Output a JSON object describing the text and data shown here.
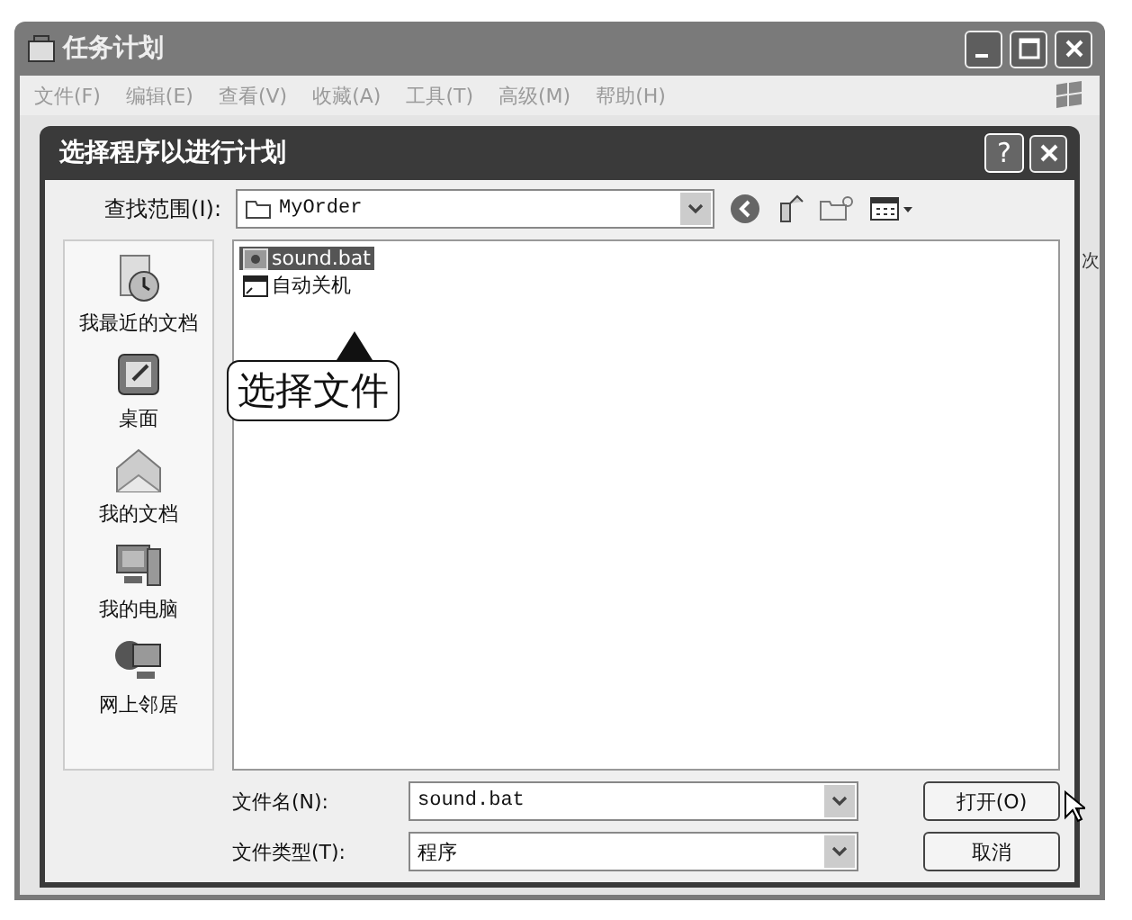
{
  "window": {
    "title": "任务计划",
    "menu": [
      "文件(F)",
      "编辑(E)",
      "查看(V)",
      "收藏(A)",
      "工具(T)",
      "高级(M)",
      "帮助(H)"
    ],
    "behind_text": "次"
  },
  "dialog": {
    "title": "选择程序以进行计划",
    "help_button": "?",
    "look_in": {
      "label": "查找范围(I):",
      "value": "MyOrder"
    },
    "places": [
      {
        "kind": "recent",
        "label": "我最近的文档"
      },
      {
        "kind": "desktop",
        "label": "桌面"
      },
      {
        "kind": "documents",
        "label": "我的文档"
      },
      {
        "kind": "computer",
        "label": "我的电脑"
      },
      {
        "kind": "network",
        "label": "网上邻居"
      }
    ],
    "files": [
      {
        "kind": "batch",
        "name": "sound.bat",
        "selected": true
      },
      {
        "kind": "shortcut",
        "name": "自动关机",
        "selected": false
      }
    ],
    "callout": "选择文件",
    "file_name": {
      "label": "文件名(N):",
      "value": "sound.bat"
    },
    "file_type": {
      "label": "文件类型(T):",
      "value": "程序"
    },
    "buttons": [
      "打开(O)",
      "取消"
    ]
  }
}
